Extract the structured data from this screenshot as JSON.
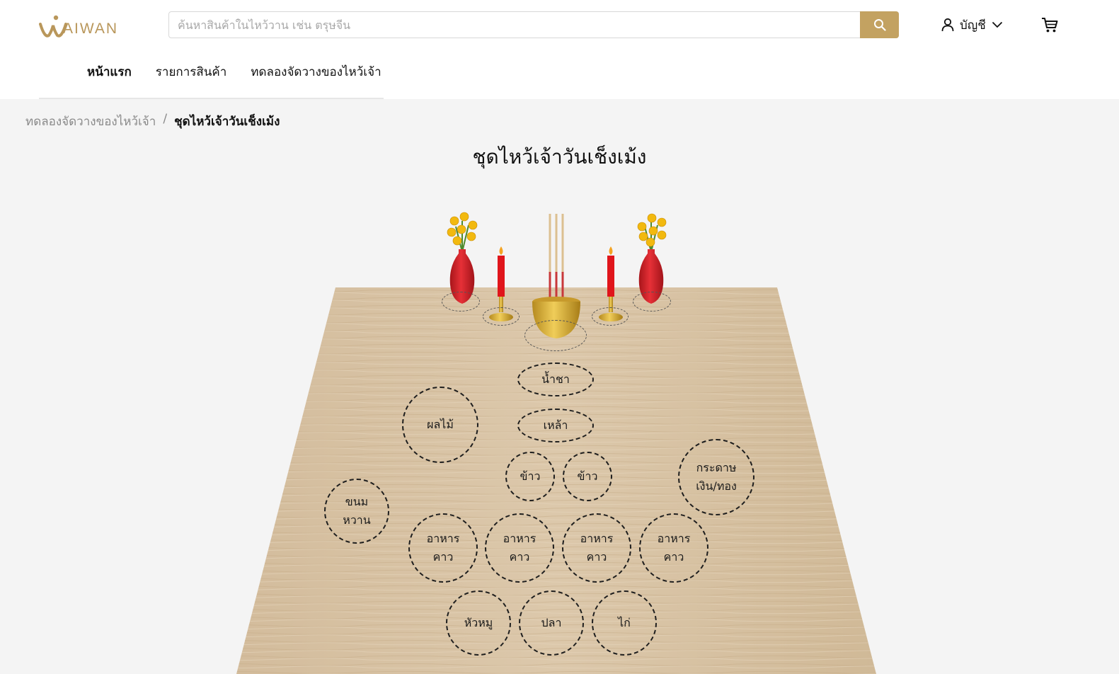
{
  "brand": {
    "name": "AIWAN"
  },
  "search": {
    "placeholder": "ค้นหาสินค้าในไหว้วาน เช่น ตรุษจีน",
    "value": ""
  },
  "account": {
    "label": "บัญชี"
  },
  "nav": {
    "items": [
      "หน้าแรก",
      "รายการสินค้า",
      "ทดลองจัดวางของไหว้เจ้า"
    ],
    "active_index": 0
  },
  "breadcrumb": {
    "parent": "ทดลองจัดวางของไหว้เจ้า",
    "separator": "/",
    "current": "ชุดไหว้เจ้าวันเช็งเม้ง"
  },
  "page": {
    "title": "ชุดไหว้เจ้าวันเช็งเม้ง"
  },
  "slots": {
    "tea": "น้ำชา",
    "liquor": "เหล้า",
    "fruit": "ผลไม้",
    "rice_1": "ข้าว",
    "rice_2": "ข้าว",
    "paper_money": "กระดาษ\nเงิน/ทอง",
    "dessert": "ขนม\nหวาน",
    "savory_1": "อาหาร\nคาว",
    "savory_2": "อาหาร\nคาว",
    "savory_3": "อาหาร\nคาว",
    "savory_4": "อาหาร\nคาว",
    "pig_head": "หัวหมู",
    "fish": "ปลา",
    "chicken": "ไก่"
  },
  "colors": {
    "accent": "#c3a261",
    "table": "#d8c3a5",
    "candle": "#e0151b",
    "vase": "#d81e24",
    "flower": "#f2b90f",
    "burner": "#d4a936"
  },
  "icons": {
    "search": "search-icon",
    "account": "user-icon",
    "dropdown": "chevron-down-icon",
    "cart": "cart-icon"
  }
}
